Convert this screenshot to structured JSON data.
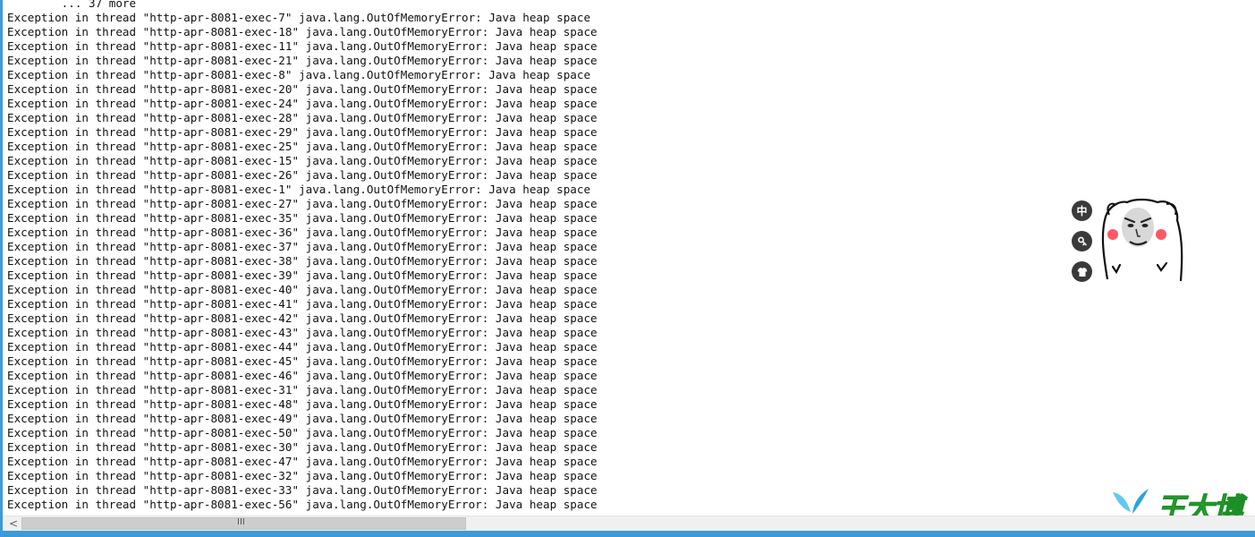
{
  "console": {
    "lines": [
      "        ... 37 more",
      "Exception in thread \"http-apr-8081-exec-7\" java.lang.OutOfMemoryError: Java heap space",
      "Exception in thread \"http-apr-8081-exec-18\" java.lang.OutOfMemoryError: Java heap space",
      "Exception in thread \"http-apr-8081-exec-11\" java.lang.OutOfMemoryError: Java heap space",
      "Exception in thread \"http-apr-8081-exec-21\" java.lang.OutOfMemoryError: Java heap space",
      "Exception in thread \"http-apr-8081-exec-8\" java.lang.OutOfMemoryError: Java heap space",
      "Exception in thread \"http-apr-8081-exec-20\" java.lang.OutOfMemoryError: Java heap space",
      "Exception in thread \"http-apr-8081-exec-24\" java.lang.OutOfMemoryError: Java heap space",
      "Exception in thread \"http-apr-8081-exec-28\" java.lang.OutOfMemoryError: Java heap space",
      "Exception in thread \"http-apr-8081-exec-29\" java.lang.OutOfMemoryError: Java heap space",
      "Exception in thread \"http-apr-8081-exec-25\" java.lang.OutOfMemoryError: Java heap space",
      "Exception in thread \"http-apr-8081-exec-15\" java.lang.OutOfMemoryError: Java heap space",
      "Exception in thread \"http-apr-8081-exec-26\" java.lang.OutOfMemoryError: Java heap space",
      "Exception in thread \"http-apr-8081-exec-1\" java.lang.OutOfMemoryError: Java heap space",
      "Exception in thread \"http-apr-8081-exec-27\" java.lang.OutOfMemoryError: Java heap space",
      "Exception in thread \"http-apr-8081-exec-35\" java.lang.OutOfMemoryError: Java heap space",
      "Exception in thread \"http-apr-8081-exec-36\" java.lang.OutOfMemoryError: Java heap space",
      "Exception in thread \"http-apr-8081-exec-37\" java.lang.OutOfMemoryError: Java heap space",
      "Exception in thread \"http-apr-8081-exec-38\" java.lang.OutOfMemoryError: Java heap space",
      "Exception in thread \"http-apr-8081-exec-39\" java.lang.OutOfMemoryError: Java heap space",
      "Exception in thread \"http-apr-8081-exec-40\" java.lang.OutOfMemoryError: Java heap space",
      "Exception in thread \"http-apr-8081-exec-41\" java.lang.OutOfMemoryError: Java heap space",
      "Exception in thread \"http-apr-8081-exec-42\" java.lang.OutOfMemoryError: Java heap space",
      "Exception in thread \"http-apr-8081-exec-43\" java.lang.OutOfMemoryError: Java heap space",
      "Exception in thread \"http-apr-8081-exec-44\" java.lang.OutOfMemoryError: Java heap space",
      "Exception in thread \"http-apr-8081-exec-45\" java.lang.OutOfMemoryError: Java heap space",
      "Exception in thread \"http-apr-8081-exec-46\" java.lang.OutOfMemoryError: Java heap space",
      "Exception in thread \"http-apr-8081-exec-31\" java.lang.OutOfMemoryError: Java heap space",
      "Exception in thread \"http-apr-8081-exec-48\" java.lang.OutOfMemoryError: Java heap space",
      "Exception in thread \"http-apr-8081-exec-49\" java.lang.OutOfMemoryError: Java heap space",
      "Exception in thread \"http-apr-8081-exec-50\" java.lang.OutOfMemoryError: Java heap space",
      "Exception in thread \"http-apr-8081-exec-30\" java.lang.OutOfMemoryError: Java heap space",
      "Exception in thread \"http-apr-8081-exec-47\" java.lang.OutOfMemoryError: Java heap space",
      "Exception in thread \"http-apr-8081-exec-32\" java.lang.OutOfMemoryError: Java heap space",
      "Exception in thread \"http-apr-8081-exec-33\" java.lang.OutOfMemoryError: Java heap space",
      "Exception in thread \"http-apr-8081-exec-56\" java.lang.OutOfMemoryError: Java heap space"
    ]
  },
  "ime_toolbar": {
    "mode_label": "中",
    "buttons": [
      {
        "icon": "ime-mode-icon"
      },
      {
        "icon": "ime-settings-icon"
      },
      {
        "icon": "ime-skin-icon"
      }
    ],
    "mascot_icon": "bear-mascot-icon"
  },
  "watermark": {
    "text": "王大博",
    "icon": "leaf-logo-icon",
    "color": "#33c23a"
  },
  "scrollbar": {
    "left_arrow": "<",
    "grip": "III",
    "thumb_fraction": 0.36
  },
  "colors": {
    "text": "#111111",
    "background": "#ffffff",
    "window_border": "#3c9bd6"
  }
}
